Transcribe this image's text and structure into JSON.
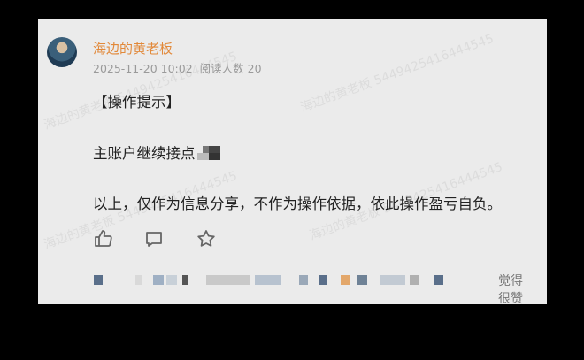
{
  "post": {
    "author": "海边的黄老板",
    "date": "2025-11-20 10:02",
    "read_count": "阅读人数 20",
    "tip": "【操作提示】",
    "line1": "主账户继续接点",
    "line2": "以上，仅作为信息分享，不作为操作依据，依此操作盈亏自负。",
    "like_label": "觉得很赞"
  },
  "watermark": "海边的黄老板 5449425416444545",
  "colors": {
    "author": "#e2893a",
    "card_bg": "#ebebeb",
    "footer_avatar_blue": "#5a6f8a",
    "footer_avatar_orange": "#e3a76a"
  },
  "icons": [
    "thumbs-up-icon",
    "comment-icon",
    "star-icon"
  ]
}
